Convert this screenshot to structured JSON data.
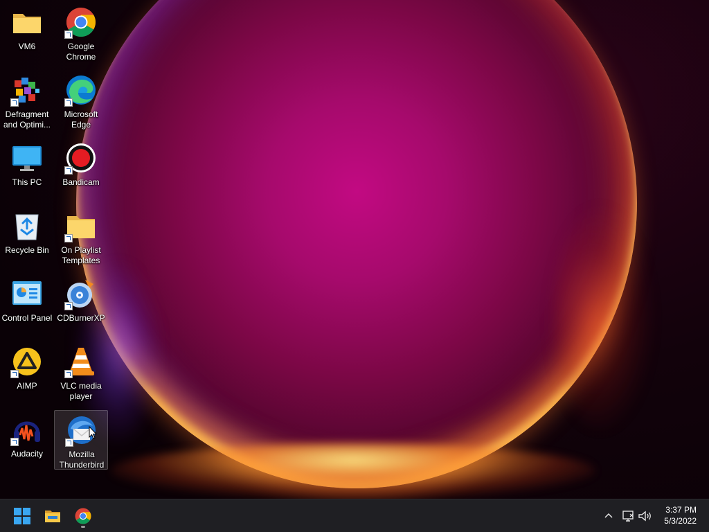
{
  "desktop": {
    "icons": [
      {
        "label": "VM6",
        "icon": "folder-icon",
        "shortcut": false
      },
      {
        "label": "Google\nChrome",
        "icon": "chrome-icon",
        "shortcut": true
      },
      {
        "label": "Defragment\nand Optimi...",
        "icon": "defragment-icon",
        "shortcut": true
      },
      {
        "label": "Microsoft\nEdge",
        "icon": "edge-icon",
        "shortcut": true
      },
      {
        "label": "This PC",
        "icon": "this-pc-icon",
        "shortcut": false
      },
      {
        "label": "Bandicam",
        "icon": "bandicam-icon",
        "shortcut": true
      },
      {
        "label": "Recycle Bin",
        "icon": "recycle-bin-icon",
        "shortcut": false
      },
      {
        "label": "On Playlist\nTemplates",
        "icon": "folder-icon",
        "shortcut": true
      },
      {
        "label": "Control Panel",
        "icon": "control-panel-icon",
        "shortcut": false
      },
      {
        "label": "CDBurnerXP",
        "icon": "cdburnerxp-icon",
        "shortcut": true
      },
      {
        "label": "AIMP",
        "icon": "aimp-icon",
        "shortcut": true
      },
      {
        "label": "VLC media\nplayer",
        "icon": "vlc-icon",
        "shortcut": true
      },
      {
        "label": "Audacity",
        "icon": "audacity-icon",
        "shortcut": true
      },
      {
        "label": "Mozilla\nThunderbird",
        "icon": "thunderbird-icon",
        "shortcut": true,
        "selected": true
      }
    ]
  },
  "taskbar": {
    "pinned": [
      {
        "name": "start-button",
        "icon": "windows-start-icon"
      },
      {
        "name": "file-explorer-button",
        "icon": "file-explorer-icon"
      },
      {
        "name": "chrome-taskbar-button",
        "icon": "chrome-icon",
        "running": true
      }
    ],
    "tray": {
      "overflow_icon": "chevron-up-icon",
      "network_icon": "network-icon",
      "volume_icon": "volume-icon"
    },
    "clock": {
      "time": "3:37 PM",
      "date": "5/3/2022"
    }
  }
}
